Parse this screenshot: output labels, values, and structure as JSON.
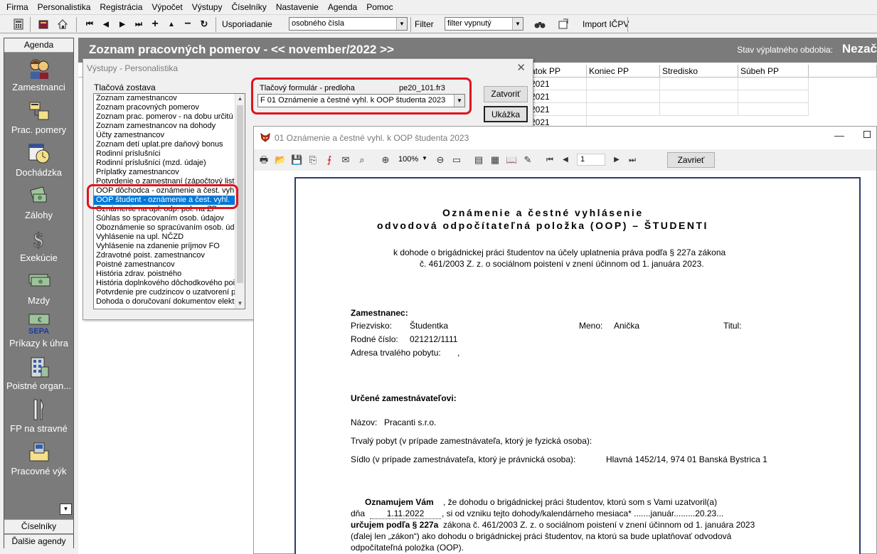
{
  "menu": [
    "Firma",
    "Personalistika",
    "Registrácia",
    "Výpočet",
    "Výstupy",
    "Číselníky",
    "Nastavenie",
    "Agenda",
    "Pomoc"
  ],
  "toolbar": {
    "sort_label": "Usporiadanie",
    "sort_value": "osobného čísla",
    "filter_label": "Filter",
    "filter_value": "filter vypnutý",
    "import_label": "Import IČPV"
  },
  "sidebar": {
    "header": "Agenda",
    "items": [
      {
        "label": "Zamestnanci",
        "icon": "employees-icon"
      },
      {
        "label": "Prac. pomery",
        "icon": "work-relations-icon"
      },
      {
        "label": "Dochádzka",
        "icon": "attendance-icon"
      },
      {
        "label": "Zálohy",
        "icon": "advances-icon"
      },
      {
        "label": "Exekúcie",
        "icon": "executions-icon"
      },
      {
        "label": "Mzdy",
        "icon": "wages-icon"
      },
      {
        "label": "Príkazy k úhra",
        "icon": "sepa-icon"
      },
      {
        "label": "Poistné organ...",
        "icon": "insurance-org-icon"
      },
      {
        "label": "FP na stravné",
        "icon": "meal-fund-icon"
      },
      {
        "label": "Pracovné výk",
        "icon": "work-reports-icon"
      }
    ],
    "bottom": [
      "Číselníky",
      "Ďalšie agendy"
    ]
  },
  "main": {
    "title": "Zoznam pracovných pomerov -  <<  november/2022  >>",
    "status_label": "Stav výplatného obdobia:",
    "status_value": "Nezač",
    "columns": [
      "atok PP",
      "Koniec PP",
      "Stredisko",
      "Súbeh PP"
    ],
    "rows": [
      "2021",
      "2021",
      "2021",
      "2021"
    ]
  },
  "dialog": {
    "title": "Výstupy - Personalistika",
    "list_label": "Tlačová zostava",
    "items": [
      "Zoznam zamestnancov",
      "Zoznam pracovných pomerov",
      "Zoznam prac. pomerov - na dobu určitú",
      "Zoznam zamestnancov na dohody",
      "Účty zamestnancov",
      "Zoznam detí uplat.pre daňový bonus",
      "Rodinní príslušníci",
      "Rodinní príslušníci (mzd. údaje)",
      "Príplatky zamestnancov",
      "Potvrdenie o zamestnaní (zápočtový list)",
      "OOP dôchodca - oznámenie a čest. vyhl.",
      "OOP študent - oznámenie a čest. vyhl.",
      "Oznámenie na upl. odp. pol. na ZP",
      "Súhlas so spracovaním osob. údajov",
      "Oboznámenie so spracúvaním osob. údaj",
      "Vyhlásenie na upl. NČZD",
      "Vyhlásenie na zdanenie príjmov FO",
      "Zdravotné poist. zamestnancov",
      "Poistné zamestnancov",
      "História zdrav. poistného",
      "História doplnkového dôchodkového pois",
      "Potvrdenie pre cudzincov o uzatvorení p",
      "Dohoda o doručovaní dokumentov elektr"
    ],
    "selected_index": 11,
    "form_label": "Tlačový formulár - predloha",
    "form_file": "pe20_101.fr3",
    "form_value": "F 01 Oznámenie a čestné vyhl. k OOP študenta 2023",
    "close_button": "Zatvoriť",
    "preview_button": "Ukážka"
  },
  "preview": {
    "title": "01 Oznámenie a čestné vyhl. k OOP študenta 2023",
    "zoom": "100%",
    "page": "1",
    "close_button": "Zavrieť",
    "doc": {
      "heading1": "Oznámenie a čestné vyhlásenie",
      "heading2": "odvodová odpočítateľná položka (OOP) – ŠTUDENTI",
      "intro1": "k dohode o brigádnickej práci študentov na účely uplatnenia práva podľa § 227a zákona",
      "intro2": "č. 461/2003 Z. z. o sociálnom poistení v znení účinnom od 1. januára 2023.",
      "employee_head": "Zamestnanec:",
      "surname_label": "Priezvisko:",
      "surname": "Študentka",
      "name_label": "Meno:",
      "name": "Anička",
      "title_label": "Titul:",
      "birth_label": "Rodné číslo:",
      "birth": "021212/1111",
      "address_label": "Adresa trvalého pobytu:",
      "address": ",",
      "employer_head": "Určené zamestnávateľovi:",
      "emp_name_label": "Názov:",
      "emp_name": "Pracanti s.r.o.",
      "emp_perm": "Trvalý pobyt (v prípade zamestnávateľa, ktorý je fyzická osoba):",
      "emp_seat_label": "Sídlo (v prípade zamestnávateľa, ktorý je právnická osoba):",
      "emp_seat": "Hlavná 1452/14, 974 01 Banská Bystrica 1",
      "notice_bold": "Oznamujem Vám",
      "notice_rest": ", že dohodu o brigádnickej práci študentov, ktorú som s Vami uzatvoril(a)",
      "day_label": "dňa",
      "day_value": "1.11.2022",
      "day_rest": ", si od vzniku tejto dohody/kalendárneho mesiaca* .......január.........20.23...",
      "claim_bold": "určujem podľa § 227a",
      "claim_rest": " zákona č. 461/2003 Z. z. o sociálnom poistení v znení účinnom od 1. januára 2023",
      "claim2": "(ďalej len „zákon“) ako dohodu o brigádnickej práci študentov, na ktorú sa bude uplatňovať odvodová",
      "claim3": "odpočítateľná položka (OOP)."
    }
  },
  "colors": {
    "sidebar": "#7b7b7b",
    "highlight": "#e0141e",
    "selection": "#0078d7"
  }
}
